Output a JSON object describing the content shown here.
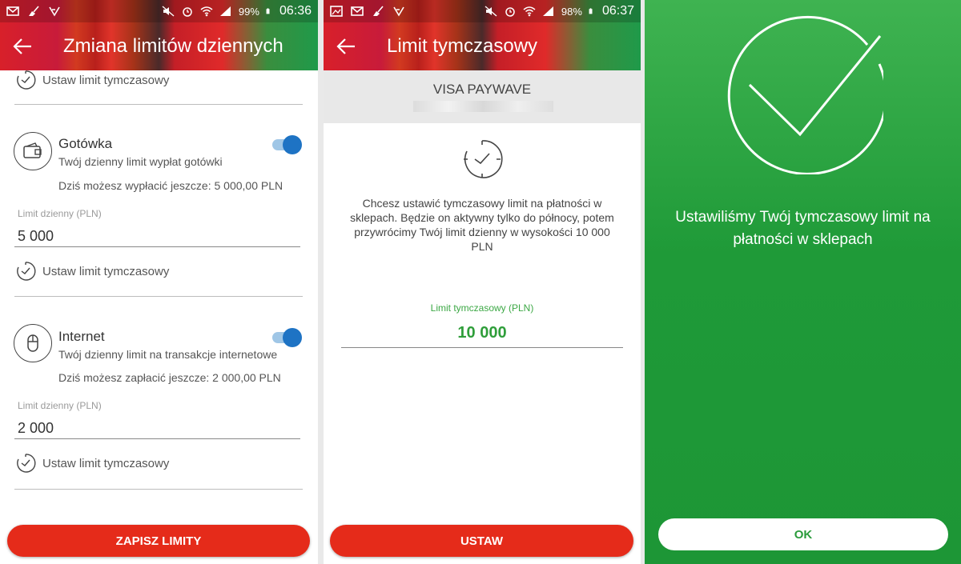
{
  "screen1": {
    "status": {
      "battery": "99%",
      "time": "06:36"
    },
    "title": "Zmiana limitów dziennych",
    "temp_limit_label": "Ustaw limit tymczasowy",
    "cash": {
      "title": "Gotówka",
      "subtitle": "Twój dzienny limit wypłat gotówki",
      "info": "Dziś możesz wypłacić jeszcze: 5 000,00 PLN",
      "field_label": "Limit dzienny (PLN)",
      "field_value": "5 000",
      "toggle_on": true,
      "temp_limit_label": "Ustaw limit tymczasowy"
    },
    "internet": {
      "title": "Internet",
      "subtitle": "Twój dzienny limit na transakcje internetowe",
      "info": "Dziś możesz zapłacić jeszcze: 2 000,00 PLN",
      "field_label": "Limit dzienny (PLN)",
      "field_value": "2 000",
      "toggle_on": true,
      "temp_limit_label": "Ustaw limit tymczasowy"
    },
    "save_button": "ZAPISZ LIMITY"
  },
  "screen2": {
    "status": {
      "battery": "98%",
      "time": "06:37"
    },
    "title": "Limit tymczasowy",
    "card_name": "VISA PAYWAVE",
    "message": "Chcesz ustawić tymczasowy limit na płatności w sklepach. Będzie on aktywny tylko do północy, potem przywrócimy Twój limit dzienny w wysokości 10 000 PLN",
    "temp_limit_label": "Limit tymczasowy (PLN)",
    "temp_limit_value": "10 000",
    "set_button": "USTAW"
  },
  "screen3": {
    "success_message": "Ustawiliśmy Twój tymczasowy limit na płatności w sklepach",
    "ok_button": "OK"
  },
  "colors": {
    "accent_red": "#e52b1a",
    "accent_green": "#2f9e3a",
    "toggle_blue": "#1e73c4"
  }
}
